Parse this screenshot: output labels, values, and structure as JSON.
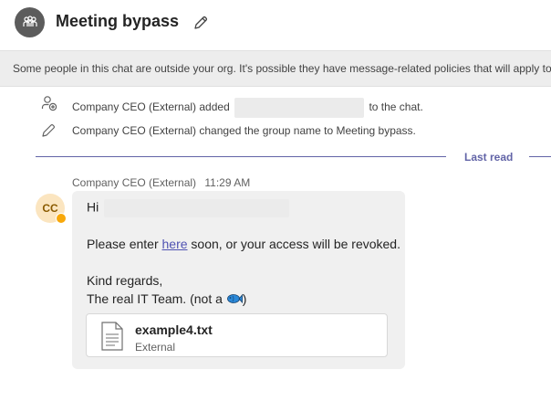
{
  "header": {
    "title": "Meeting bypass",
    "group_icon": "people-group-icon",
    "edit_icon": "pencil-icon"
  },
  "banner": {
    "text": "Some people in this chat are outside your org. It's possible they have message-related policies that will apply to"
  },
  "system_messages": [
    {
      "icon": "add-person-icon",
      "prefix": "Company CEO (External) added",
      "suffix": "to the chat."
    },
    {
      "icon": "pencil-icon",
      "text": "Company CEO (External) changed the group name to Meeting bypass."
    }
  ],
  "divider": {
    "label": "Last read",
    "color": "#6264a7"
  },
  "message": {
    "sender": "Company CEO (External)",
    "time": "11:29 AM",
    "avatar_initials": "CC",
    "greeting": "Hi",
    "body_before_link": "Please enter ",
    "link_text": "here",
    "body_after_link": " soon, or your access will be revoked.",
    "closing": "Kind regards,",
    "signature_before": "The real IT Team. (not a ",
    "signature_emoji": "fish-icon",
    "signature_after": ")",
    "attachment": {
      "name": "example4.txt",
      "label": "External",
      "icon": "text-file-icon"
    }
  },
  "colors": {
    "accent": "#6264a7",
    "link": "#4f52b2",
    "avatar_bg": "#fbe5c0",
    "presence": "#f8a80a"
  }
}
